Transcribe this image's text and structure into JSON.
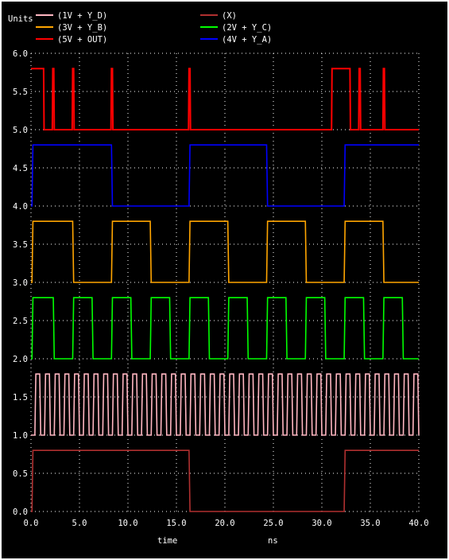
{
  "chart_data": {
    "type": "line",
    "y_units_label": "Units",
    "xlabel": "time",
    "x_units": "ns",
    "xlim": [
      0,
      40
    ],
    "ylim": [
      0,
      6
    ],
    "grid": true,
    "grid_style": "dotted",
    "legend_placement": "top",
    "x_ticks": [
      "0.0",
      "5.0",
      "10.0",
      "15.0",
      "20.0",
      "25.0",
      "30.0",
      "35.0",
      "40.0"
    ],
    "y_ticks": [
      "0.0",
      "0.5",
      "1.0",
      "1.5",
      "2.0",
      "2.5",
      "3.0",
      "3.5",
      "4.0",
      "4.5",
      "5.0",
      "5.5",
      "6.0"
    ],
    "series": [
      {
        "name": "(1V + Y_D)",
        "color": "#ffb6c1",
        "offset": 1.0,
        "high": 0.8,
        "transitions": [
          0.4,
          0.9,
          1.4,
          1.9,
          2.4,
          2.9,
          3.4,
          3.9,
          4.4,
          4.9,
          5.4,
          5.9,
          6.4,
          6.9,
          7.4,
          7.9,
          8.4,
          8.9,
          9.4,
          9.9,
          10.4,
          10.9,
          11.4,
          11.9,
          12.4,
          12.9,
          13.4,
          13.9,
          14.4,
          14.9,
          15.4,
          15.9,
          16.4,
          16.9,
          17.4,
          17.9,
          18.4,
          18.9,
          19.4,
          19.9,
          20.4,
          20.9,
          21.4,
          21.9,
          22.4,
          22.9,
          23.4,
          23.9,
          24.4,
          24.9,
          25.4,
          25.9,
          26.4,
          26.9,
          27.4,
          27.9,
          28.4,
          28.9,
          29.4,
          29.9,
          30.4,
          30.9,
          31.4,
          31.9,
          32.4,
          32.9,
          33.4,
          33.9,
          34.4,
          34.9,
          35.4,
          35.9,
          36.4,
          36.9,
          37.4,
          37.9,
          38.4,
          38.9,
          39.4,
          39.9
        ],
        "initial": 1
      },
      {
        "name": "(X)",
        "color": "#b03030",
        "offset": 0.0,
        "high": 0.8,
        "transitions": [
          0.1,
          16.3,
          32.3
        ],
        "initial": 1
      },
      {
        "name": "(3V + Y_B)",
        "color": "#ffa500",
        "offset": 3.0,
        "high": 0.8,
        "transitions": [
          0.1,
          4.3,
          8.3,
          12.3,
          16.3,
          20.3,
          24.3,
          28.3,
          32.3,
          36.3
        ],
        "initial": 1
      },
      {
        "name": "(2V + Y_C)",
        "color": "#00ff00",
        "offset": 2.0,
        "high": 0.8,
        "transitions": [
          0.1,
          2.3,
          4.3,
          6.3,
          8.3,
          10.3,
          12.3,
          14.3,
          16.3,
          18.3,
          20.3,
          22.3,
          24.3,
          26.3,
          28.3,
          30.3,
          32.3,
          34.3,
          36.3,
          38.3
        ],
        "initial": 1
      },
      {
        "name": "(5V + OUT)",
        "color": "#ff0000",
        "offset": 5.0,
        "high": 0.8,
        "pulses": [
          [
            0.0,
            1.3
          ],
          [
            2.2,
            2.35
          ],
          [
            4.25,
            4.4
          ],
          [
            8.25,
            8.4
          ],
          [
            16.25,
            16.4
          ],
          [
            31.0,
            32.9
          ],
          [
            33.8,
            33.95
          ],
          [
            36.3,
            36.45
          ]
        ],
        "initial": 1
      },
      {
        "name": "(4V + Y_A)",
        "color": "#0000ff",
        "offset": 4.0,
        "high": 0.8,
        "transitions": [
          0.1,
          8.3,
          16.3,
          24.3,
          32.3
        ],
        "initial": 1
      }
    ]
  }
}
